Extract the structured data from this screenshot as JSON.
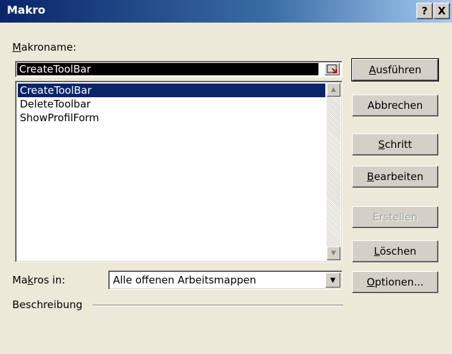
{
  "window": {
    "title": "Makro",
    "help_button": "?",
    "close_button": "X"
  },
  "macro_name": {
    "label_accel": "M",
    "label_rest": "akroname:",
    "value": "CreateToolBar"
  },
  "macro_list": {
    "items": [
      "CreateToolBar",
      "DeleteToolbar",
      "ShowProfilForm"
    ],
    "selected_index": 0
  },
  "macros_in": {
    "label_pre": "Ma",
    "label_accel": "k",
    "label_post": "ros in:",
    "selected": "Alle offenen Arbeitsmappen"
  },
  "description": {
    "label": "Beschreibung"
  },
  "buttons": {
    "run": {
      "accel": "A",
      "rest": "usführen"
    },
    "cancel": {
      "label": "Abbrechen"
    },
    "step": {
      "accel": "S",
      "rest": "chritt"
    },
    "edit": {
      "accel": "B",
      "rest": "earbeiten"
    },
    "create": {
      "label": "Erstellen",
      "enabled": false
    },
    "delete": {
      "accel": "L",
      "rest": "öschen"
    },
    "options": {
      "accel": "O",
      "rest": "ptionen..."
    }
  },
  "colors": {
    "titlebar_start": "#0a246a",
    "titlebar_end": "#a6caf0",
    "selection": "#0a246a",
    "face": "#ece9d8"
  }
}
